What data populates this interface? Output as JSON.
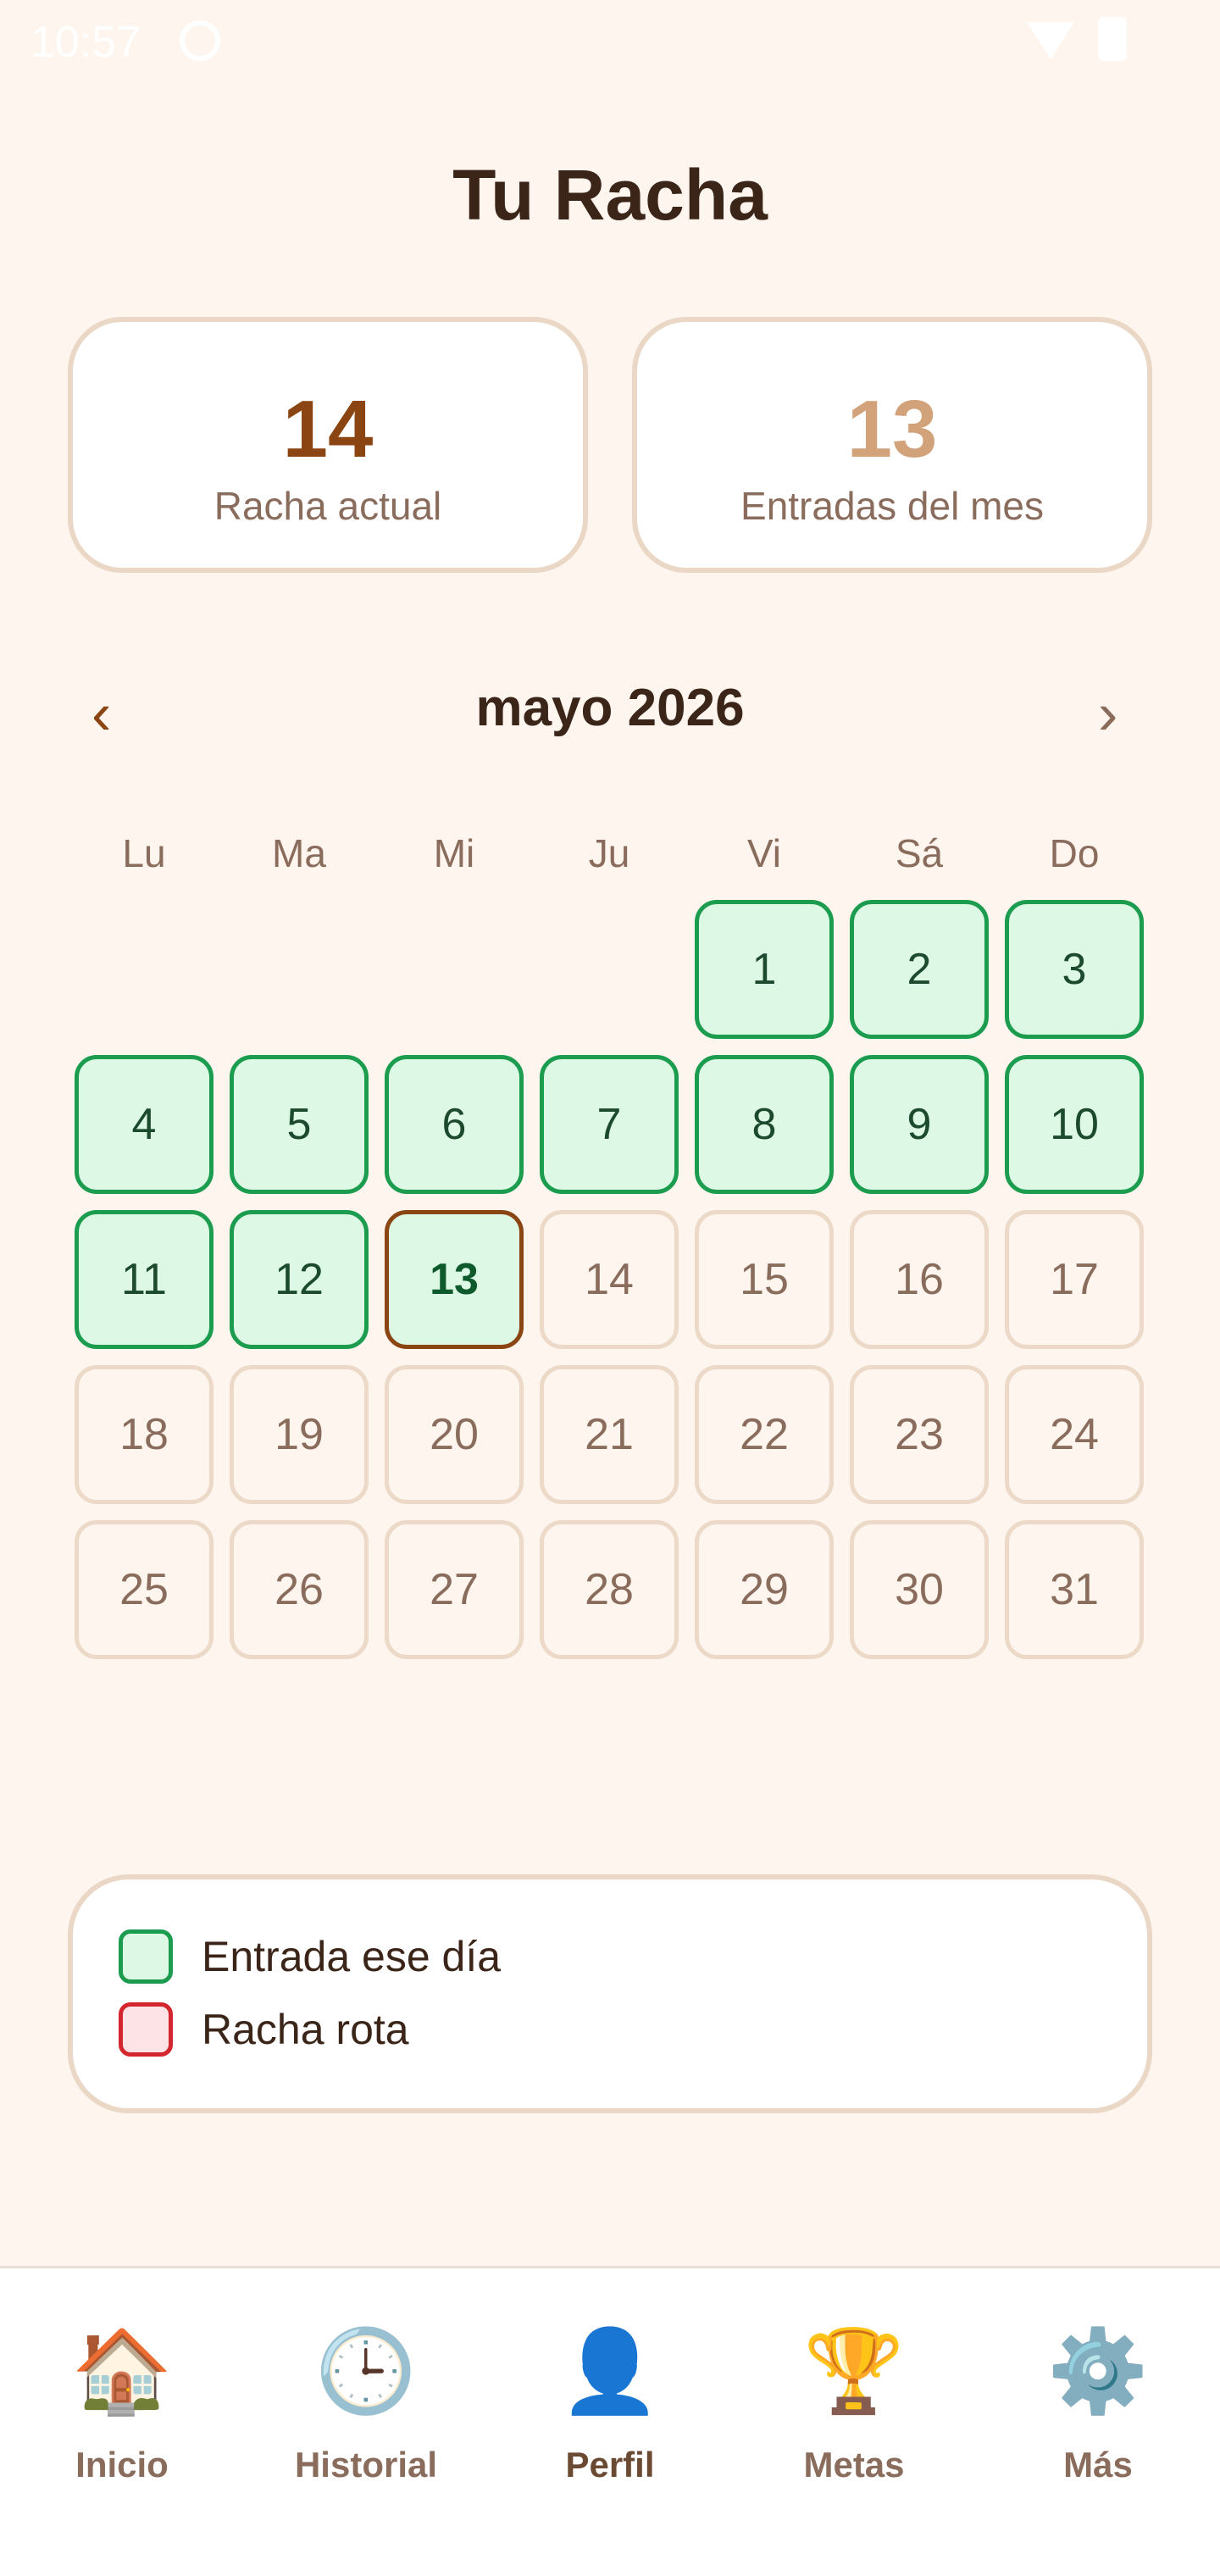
{
  "status_bar": {
    "time": "10:57"
  },
  "title": "Tu Racha",
  "stats": [
    {
      "value": "14",
      "label": "Racha actual",
      "color": "#8B4513"
    },
    {
      "value": "13",
      "label": "Entradas del mes",
      "color": "#D2A27A"
    }
  ],
  "calendar": {
    "month_label": "mayo 2026",
    "prev_glyph": "‹",
    "next_glyph": "›",
    "weekdays": [
      "Lu",
      "Ma",
      "Mi",
      "Ju",
      "Vi",
      "Sá",
      "Do"
    ],
    "first_weekday_index": 4,
    "days_in_month": 31,
    "entry_days": [
      1,
      2,
      3,
      4,
      5,
      6,
      7,
      8,
      9,
      10,
      11,
      12
    ],
    "today": 13
  },
  "legend": {
    "entry_label": "Entrada ese día",
    "broken_label": "Racha rota",
    "entry_color": "#1C9C4E",
    "broken_color": "#D3262F"
  },
  "nav": [
    {
      "label": "Inicio",
      "icon": "🏠",
      "icon_name": "home-icon"
    },
    {
      "label": "Historial",
      "icon": "🕒",
      "icon_name": "clock-icon"
    },
    {
      "label": "Perfil",
      "icon": "👤",
      "icon_name": "profile-icon",
      "active": true
    },
    {
      "label": "Metas",
      "icon": "🏆",
      "icon_name": "trophy-icon"
    },
    {
      "label": "Más",
      "icon": "⚙️",
      "icon_name": "gear-icon"
    }
  ]
}
